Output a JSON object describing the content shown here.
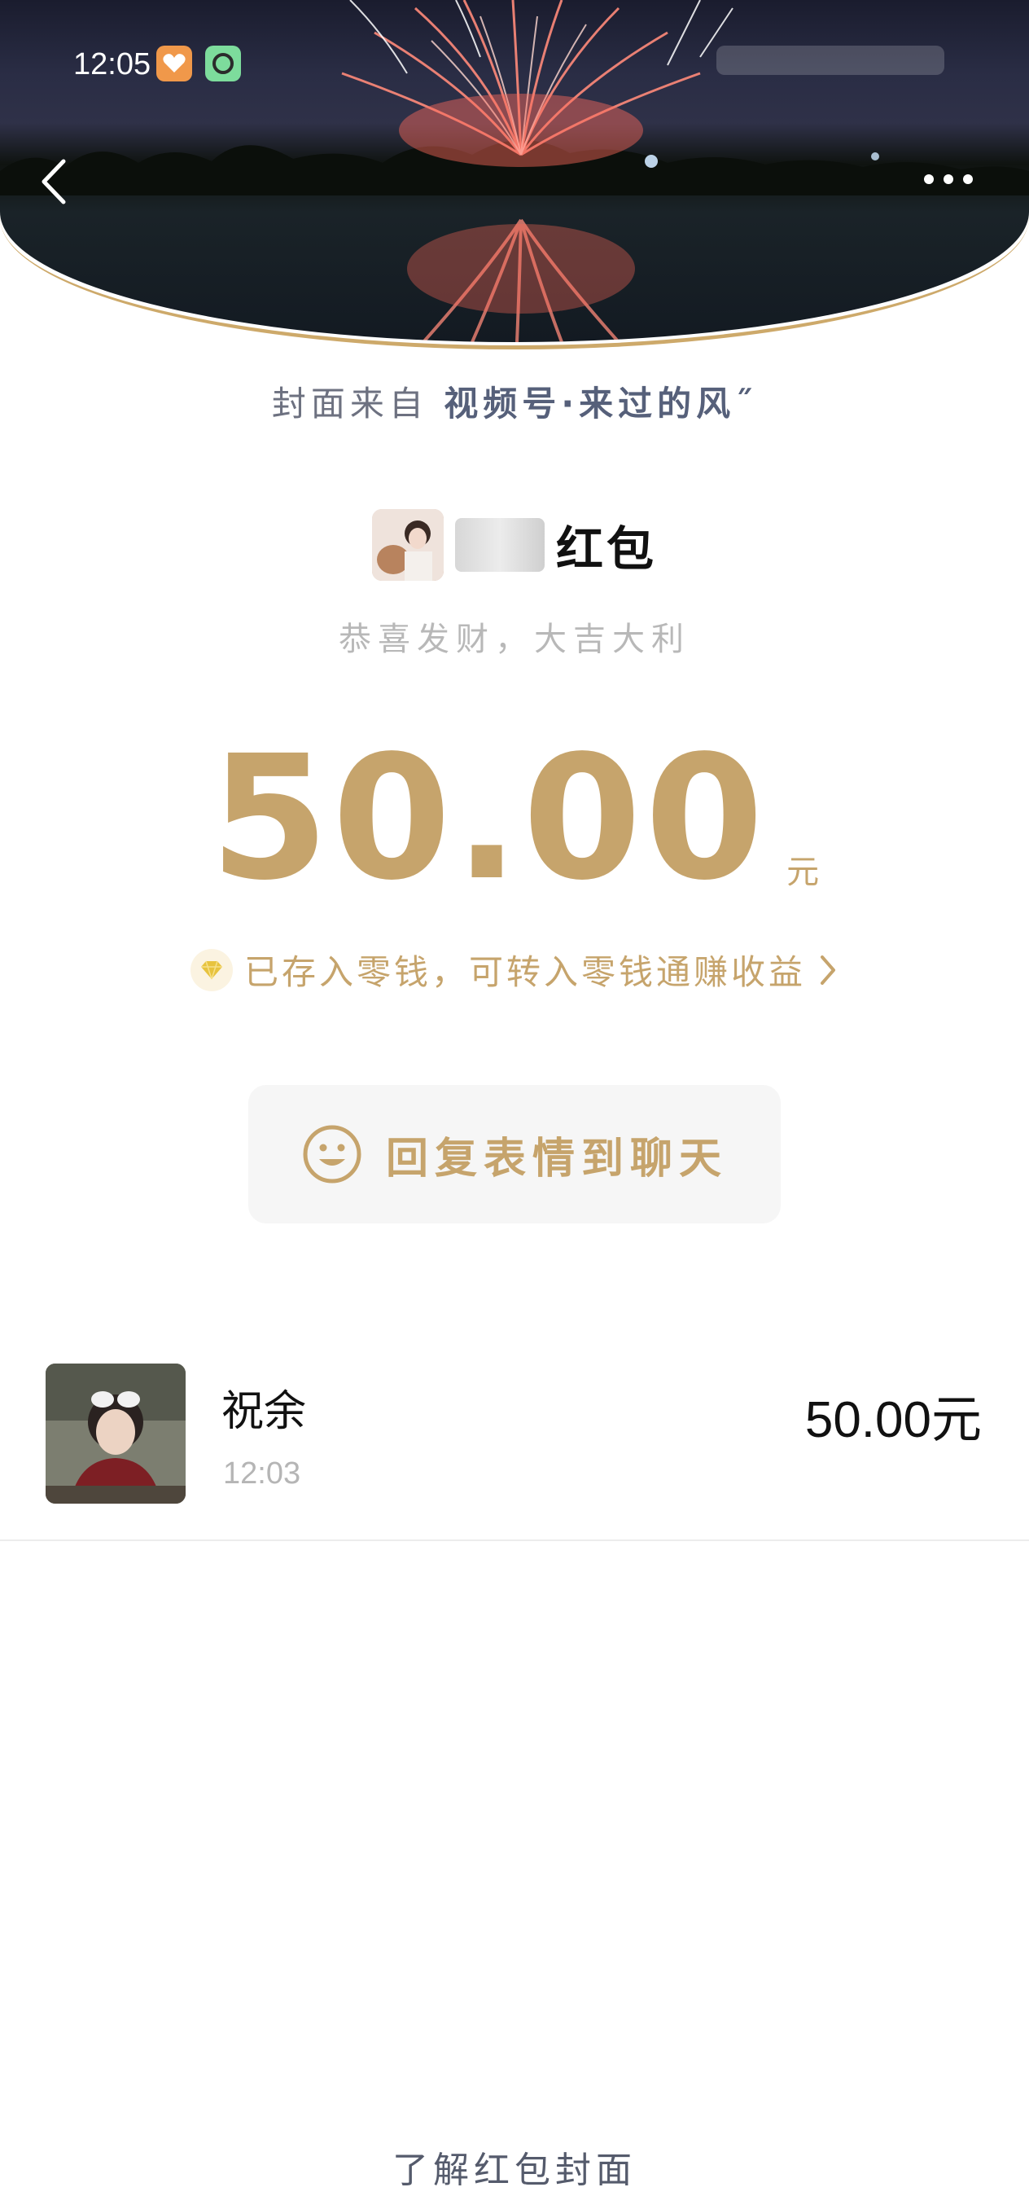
{
  "status_bar": {
    "time": "12:05"
  },
  "cover": {
    "source_prefix": "封面来自",
    "source_name": "视频号·来过的风˝"
  },
  "sender": {
    "title": "红包",
    "greeting": "恭喜发财，大吉大利"
  },
  "amount": {
    "value": "50.00",
    "unit": "元"
  },
  "wallet_note": {
    "text": "已存入零钱，可转入零钱通赚收益"
  },
  "reply": {
    "label": "回复表情到聊天"
  },
  "records": [
    {
      "name": "祝余",
      "time": "12:03",
      "amount": "50.00元"
    }
  ],
  "footer": {
    "link": "了解红包封面"
  },
  "colors": {
    "gold": "#c6a46c",
    "rim": "#cda96a"
  }
}
